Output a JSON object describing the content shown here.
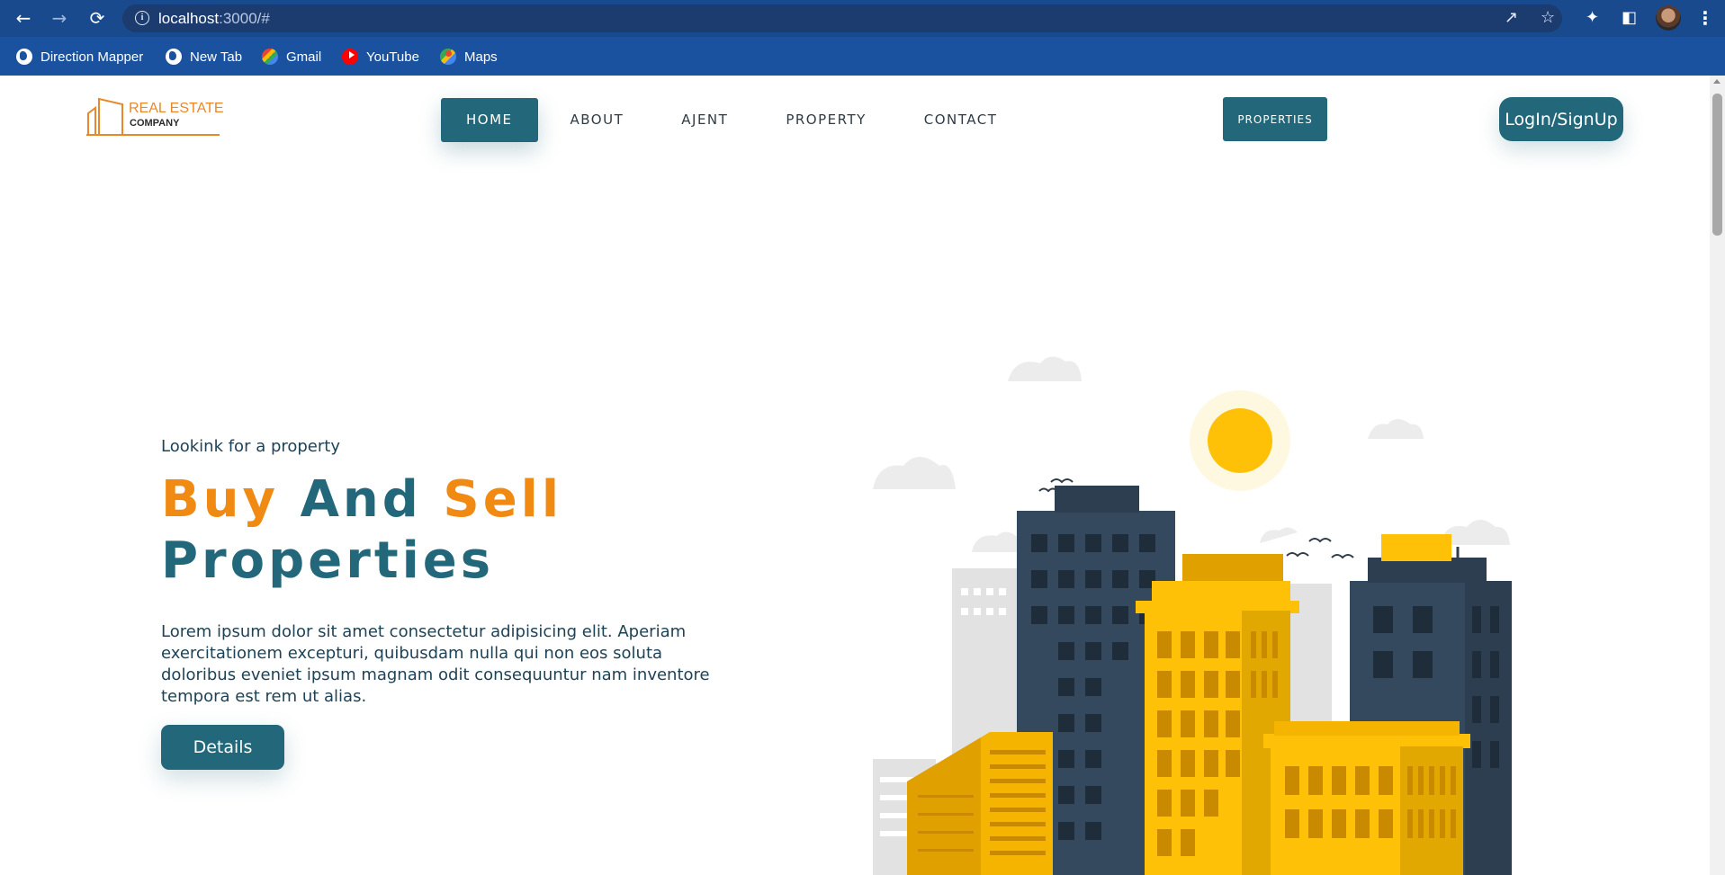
{
  "browser": {
    "url_host": "localhost",
    "url_path": ":3000/#",
    "bookmarks": [
      {
        "label": "Direction Mapper",
        "icon": "globe-icon"
      },
      {
        "label": "New Tab",
        "icon": "globe-icon"
      },
      {
        "label": "Gmail",
        "icon": "gmail-icon"
      },
      {
        "label": "YouTube",
        "icon": "youtube-icon"
      },
      {
        "label": "Maps",
        "icon": "maps-icon"
      }
    ]
  },
  "logo": {
    "title": "REAL ESTATE",
    "subtitle": "COMPANY"
  },
  "nav": {
    "items": [
      {
        "label": "HOME",
        "active": true
      },
      {
        "label": "ABOUT",
        "active": false
      },
      {
        "label": "AJENT",
        "active": false
      },
      {
        "label": "PROPERTY",
        "active": false
      },
      {
        "label": "CONTACT",
        "active": false
      }
    ],
    "properties_label": "PROPERTIES",
    "login_label": "LogIn/SignUp"
  },
  "hero": {
    "subtitle": "Lookink for a property",
    "title_word1": "Buy",
    "title_word2": "And",
    "title_word3": "Sell",
    "title_line2": "Properties",
    "description": "Lorem ipsum dolor sit amet consectetur adipisicing elit. Aperiam exercitationem excepturi, quibusdam nulla qui non eos soluta doloribus eveniet ipsum magnam odit consequuntur nam inventore tempora est rem ut alias.",
    "button_label": "Details"
  },
  "colors": {
    "primary": "#23687a",
    "accent": "#f08a12",
    "browser_bar": "#1a52a0"
  }
}
